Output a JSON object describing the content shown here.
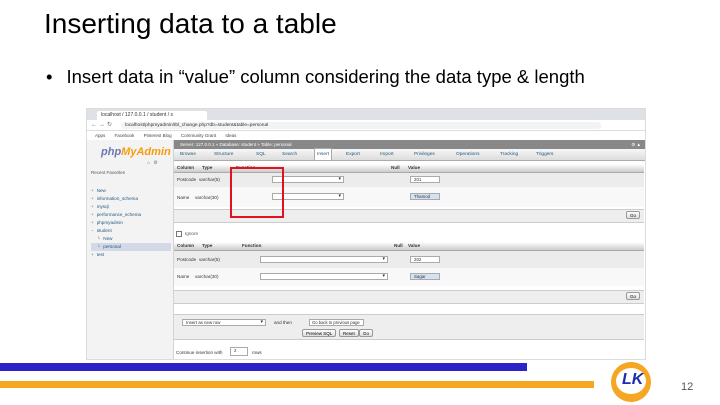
{
  "slide": {
    "title": "Inserting data to a table",
    "bullet": "Insert data in “value” column considering the data type & length",
    "page_number": "12",
    "logo_text": "LK"
  },
  "browser": {
    "tab_title": "localhost / 127.0.0.1 / student / s",
    "url": "localhost/phpmyadmin/tbl_change.php?db=student&table=personal",
    "bookmarks": [
      "Apps",
      "Facebook",
      "Pinterest Blog",
      "Community Grant",
      "Ideas"
    ]
  },
  "pma": {
    "logo_a": "php",
    "logo_b": "MyAdmin",
    "recent_label": "Recent   Favorites",
    "tree": [
      {
        "label": "New",
        "indent": 0
      },
      {
        "label": "information_schema",
        "indent": 0
      },
      {
        "label": "mysql",
        "indent": 0
      },
      {
        "label": "performance_schema",
        "indent": 0
      },
      {
        "label": "phpmyadmin",
        "indent": 0
      },
      {
        "label": "student",
        "indent": 0
      },
      {
        "label": "New",
        "indent": 1
      },
      {
        "label": "personal",
        "indent": 1
      },
      {
        "label": "test",
        "indent": 0
      }
    ],
    "breadcrumb": "Server: 127.0.0.1 » Database: student » Table: personal",
    "menu": [
      "Browse",
      "Structure",
      "SQL",
      "Search",
      "Insert",
      "Export",
      "Import",
      "Privileges",
      "Operations",
      "Tracking",
      "Triggers"
    ],
    "headers": {
      "column": "Column",
      "type": "Type",
      "function": "Function",
      "null": "Null",
      "value": "Value"
    },
    "block1": [
      {
        "column": "Postcode",
        "type": "varchar(5)",
        "value": "201"
      },
      {
        "column": "Name",
        "type": "varchar(30)",
        "value": "Thamod"
      }
    ],
    "block2": [
      {
        "column": "Postcode",
        "type": "varchar(5)",
        "value": "202"
      },
      {
        "column": "Name",
        "type": "varchar(30)",
        "value": "Sagar"
      }
    ],
    "go_label": "Go",
    "ignore_label": "Ignore",
    "insert_mode": "Insert as new row",
    "and_then": "and then",
    "after_insert": "Go back to previous page",
    "preview_label": "Preview SQL",
    "reset_label": "Reset",
    "continue_label": "Continue insertion with",
    "continue_rows": "2",
    "rows_label": "rows"
  }
}
